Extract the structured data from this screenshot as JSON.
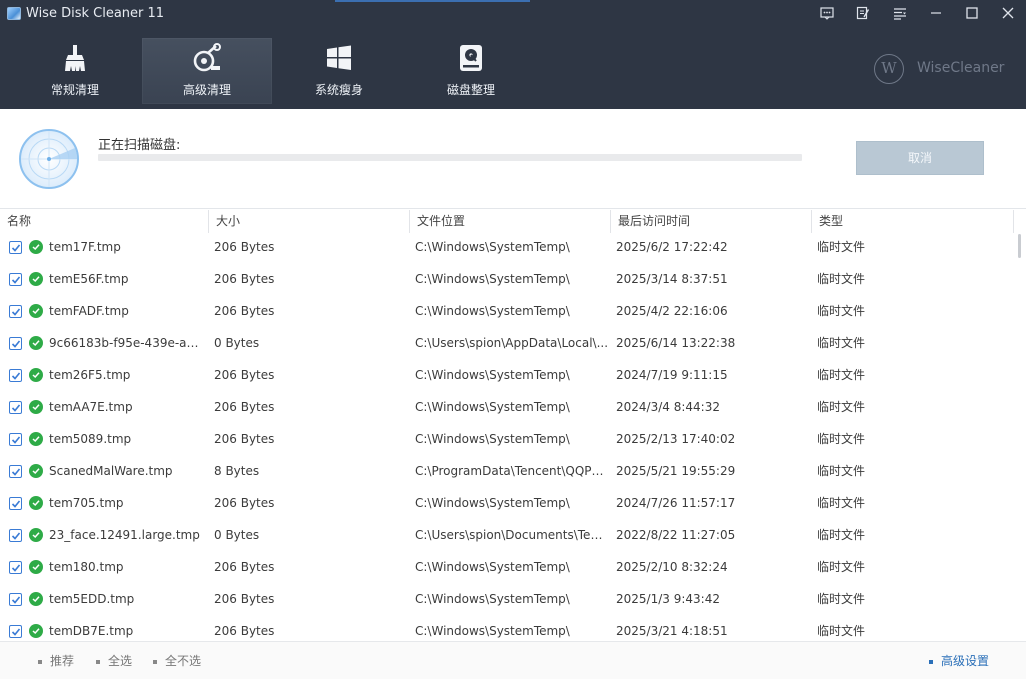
{
  "window": {
    "title": "Wise Disk Cleaner 11"
  },
  "tabs": [
    {
      "label": "常规清理",
      "icon": "broom-icon",
      "active": false
    },
    {
      "label": "高级清理",
      "icon": "advanced-clean-icon",
      "active": true
    },
    {
      "label": "系统瘦身",
      "icon": "windows-icon",
      "active": false
    },
    {
      "label": "磁盘整理",
      "icon": "disk-defrag-icon",
      "active": false
    }
  ],
  "brand": {
    "mark": "W",
    "name": "WiseCleaner"
  },
  "scan": {
    "status_label": "正在扫描磁盘:",
    "cancel_label": "取消",
    "progress": 0.0
  },
  "table": {
    "columns": [
      "名称",
      "大小",
      "文件位置",
      "最后访问时间",
      "类型"
    ],
    "rows": [
      {
        "name": "tem17F.tmp",
        "size": "206 Bytes",
        "location": "C:\\Windows\\SystemTemp\\",
        "accessed": "2025/6/2 17:22:42",
        "type": "临时文件"
      },
      {
        "name": "temE56F.tmp",
        "size": "206 Bytes",
        "location": "C:\\Windows\\SystemTemp\\",
        "accessed": "2025/3/14 8:37:51",
        "type": "临时文件"
      },
      {
        "name": "temFADF.tmp",
        "size": "206 Bytes",
        "location": "C:\\Windows\\SystemTemp\\",
        "accessed": "2025/4/2 22:16:06",
        "type": "临时文件"
      },
      {
        "name": "9c66183b-f95e-439e-aed...",
        "size": "0 Bytes",
        "location": "C:\\Users\\spion\\AppData\\Local\\...",
        "accessed": "2025/6/14 13:22:38",
        "type": "临时文件"
      },
      {
        "name": "tem26F5.tmp",
        "size": "206 Bytes",
        "location": "C:\\Windows\\SystemTemp\\",
        "accessed": "2024/7/19 9:11:15",
        "type": "临时文件"
      },
      {
        "name": "temAA7E.tmp",
        "size": "206 Bytes",
        "location": "C:\\Windows\\SystemTemp\\",
        "accessed": "2024/3/4 8:44:32",
        "type": "临时文件"
      },
      {
        "name": "tem5089.tmp",
        "size": "206 Bytes",
        "location": "C:\\Windows\\SystemTemp\\",
        "accessed": "2025/2/13 17:40:02",
        "type": "临时文件"
      },
      {
        "name": "ScanedMalWare.tmp",
        "size": "8 Bytes",
        "location": "C:\\ProgramData\\Tencent\\QQPC...",
        "accessed": "2025/5/21 19:55:29",
        "type": "临时文件"
      },
      {
        "name": "tem705.tmp",
        "size": "206 Bytes",
        "location": "C:\\Windows\\SystemTemp\\",
        "accessed": "2024/7/26 11:57:17",
        "type": "临时文件"
      },
      {
        "name": "23_face.12491.large.tmp",
        "size": "0 Bytes",
        "location": "C:\\Users\\spion\\Documents\\Ten...",
        "accessed": "2022/8/22 11:27:05",
        "type": "临时文件"
      },
      {
        "name": "tem180.tmp",
        "size": "206 Bytes",
        "location": "C:\\Windows\\SystemTemp\\",
        "accessed": "2025/2/10 8:32:24",
        "type": "临时文件"
      },
      {
        "name": "tem5EDD.tmp",
        "size": "206 Bytes",
        "location": "C:\\Windows\\SystemTemp\\",
        "accessed": "2025/1/3 9:43:42",
        "type": "临时文件"
      },
      {
        "name": "temDB7E.tmp",
        "size": "206 Bytes",
        "location": "C:\\Windows\\SystemTemp\\",
        "accessed": "2025/3/21 4:18:51",
        "type": "临时文件"
      }
    ]
  },
  "footer": {
    "recommend": "推荐",
    "select_all": "全选",
    "select_none": "全不选",
    "advanced_settings": "高级设置"
  },
  "colors": {
    "titlebar": "#2e3644",
    "accent": "#3b6fb1",
    "ok_green": "#2eab47",
    "link_blue": "#2a6fb8"
  }
}
